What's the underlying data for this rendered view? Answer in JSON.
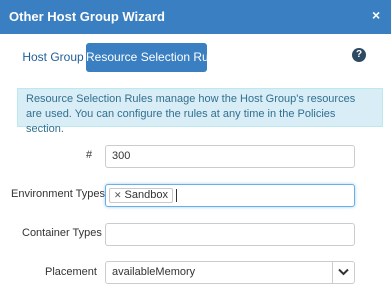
{
  "window": {
    "title": "Other Host Group Wizard",
    "close_icon": "×"
  },
  "tabs": [
    {
      "label": "Host Group",
      "active": false
    },
    {
      "label": "Resource Selection Rule",
      "active": true
    }
  ],
  "help_icon": "?",
  "info_text": "Resource Selection Rules manage how the Host Group's resources are used. You can configure the rules at any time in the Policies section.",
  "form": {
    "number_label": "#",
    "number_value": "300",
    "environment_types_label": "Environment Types",
    "environment_types_tokens": [
      "Sandbox"
    ],
    "container_types_label": "Container Types",
    "container_types_value": "",
    "placement_label": "Placement",
    "placement_value": "availableMemory"
  },
  "colors": {
    "title_bar": "#3a7fc1",
    "active_tab": "#3a7fc1",
    "info_background": "#d9edf7",
    "info_text": "#31708f"
  }
}
